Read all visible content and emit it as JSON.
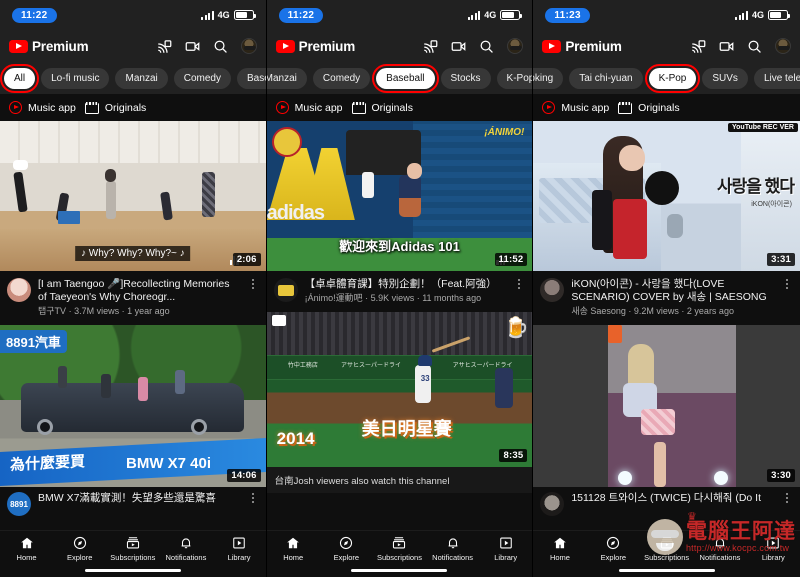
{
  "app": {
    "brand": "Premium",
    "yt_logo_color": "#ff0000",
    "header_icons": [
      "cast-icon",
      "add-video-icon",
      "search-icon",
      "avatar"
    ]
  },
  "panels": [
    {
      "status": {
        "time": "11:22",
        "network": "4G",
        "signal_bars": 4,
        "battery_pct": 72
      },
      "chips": [
        {
          "label": "All",
          "active": true,
          "highlighted": true
        },
        {
          "label": "Lo-fi music",
          "active": false,
          "highlighted": false
        },
        {
          "label": "Manzai",
          "active": false,
          "highlighted": false
        },
        {
          "label": "Comedy",
          "active": false,
          "highlighted": false
        },
        {
          "label": "Baseb",
          "active": false,
          "highlighted": false
        }
      ],
      "shelf": [
        {
          "label": "Music app",
          "icon": "music-app-icon"
        },
        {
          "label": "Originals",
          "icon": "originals-icon"
        }
      ],
      "videos": [
        {
          "title": "[I am Taengoo 🎤]Recollecting Memories of Taeyeon's Why Choreogr...",
          "channel": "탭구TV",
          "views": "3.7M views",
          "age": "1 year ago",
          "duration": "2:06",
          "caption_overlay": "♪ Why? Why? Why?~ ♪",
          "has_cc_badge": true
        },
        {
          "title": "BMW X7滿載實測！失望多些還是驚喜",
          "overlay_brand": "8891汽車",
          "overlay_text": "BMW X7 40i",
          "overlay_text2": "為什麼要買",
          "duration": "14:06"
        }
      ],
      "bottom_nav": [
        {
          "label": "Home",
          "icon": "home-icon",
          "active": true
        },
        {
          "label": "Explore",
          "icon": "compass-icon",
          "active": false
        },
        {
          "label": "Subscriptions",
          "icon": "subscriptions-icon",
          "active": false
        },
        {
          "label": "Notifications",
          "icon": "bell-icon",
          "active": false
        },
        {
          "label": "Library",
          "icon": "library-icon",
          "active": false
        }
      ]
    },
    {
      "status": {
        "time": "11:22",
        "network": "4G",
        "signal_bars": 4,
        "battery_pct": 72
      },
      "chips": [
        {
          "label": "Manzai",
          "active": false,
          "highlighted": false
        },
        {
          "label": "Comedy",
          "active": false,
          "highlighted": false
        },
        {
          "label": "Baseball",
          "active": true,
          "highlighted": true
        },
        {
          "label": "Stocks",
          "active": false,
          "highlighted": false
        },
        {
          "label": "K-Pop",
          "active": false,
          "highlighted": false
        }
      ],
      "shelf": [
        {
          "label": "Music app",
          "icon": "music-app-icon"
        },
        {
          "label": "Originals",
          "icon": "originals-icon"
        }
      ],
      "videos": [
        {
          "title": "【卓卓體育課】特別企劃！（Feat.阿強）",
          "channel": "¡Ánimo!運動吧",
          "views": "5.9K views",
          "age": "11 months ago",
          "duration": "11:52",
          "caption_overlay": "歡迎來到Adidas 101",
          "has_cc_badge": true
        },
        {
          "title": "",
          "overlay_text": "2014",
          "overlay_text2": "美日明星賽",
          "duration": "8:35",
          "strip_text": "台南Josh viewers also watch this channel"
        }
      ],
      "bottom_nav": [
        {
          "label": "Home",
          "icon": "home-icon",
          "active": true
        },
        {
          "label": "Explore",
          "icon": "compass-icon",
          "active": false
        },
        {
          "label": "Subscriptions",
          "icon": "subscriptions-icon",
          "active": false
        },
        {
          "label": "Notifications",
          "icon": "bell-icon",
          "active": false
        },
        {
          "label": "Library",
          "icon": "library-icon",
          "active": false
        }
      ]
    },
    {
      "status": {
        "time": "11:23",
        "network": "4G",
        "signal_bars": 4,
        "battery_pct": 72
      },
      "chips": [
        {
          "label": "oking",
          "active": false,
          "highlighted": false
        },
        {
          "label": "Tai chi-yuan",
          "active": false,
          "highlighted": false
        },
        {
          "label": "K-Pop",
          "active": true,
          "highlighted": true
        },
        {
          "label": "SUVs",
          "active": false,
          "highlighted": false
        },
        {
          "label": "Live televis",
          "active": false,
          "highlighted": false
        }
      ],
      "shelf": [
        {
          "label": "Music app",
          "icon": "music-app-icon"
        },
        {
          "label": "Originals",
          "icon": "originals-icon"
        }
      ],
      "videos": [
        {
          "title": "iKON(아이콘) - 사랑을 했다(LOVE SCENARIO) COVER by 새송 | SAESONG",
          "channel": "새송 Saesong",
          "views": "9.2M views",
          "age": "2 years ago",
          "duration": "3:31",
          "caption_overlay": "사랑을 했다",
          "badge": "YouTube REC VER"
        },
        {
          "title": "151128 트와이스 (TWICE) 다시해줘 (Do It",
          "duration": "3:30"
        }
      ],
      "bottom_nav": [
        {
          "label": "Home",
          "icon": "home-icon",
          "active": true
        },
        {
          "label": "Explore",
          "icon": "compass-icon",
          "active": false
        },
        {
          "label": "Subscriptions",
          "icon": "subscriptions-icon",
          "active": false
        },
        {
          "label": "Notifications",
          "icon": "bell-icon",
          "active": false
        },
        {
          "label": "Library",
          "icon": "library-icon",
          "active": false
        }
      ]
    }
  ],
  "watermark": {
    "text": "電腦王阿達",
    "url": "http://www.kocpc.com.tw",
    "color": "#c62828"
  },
  "colors": {
    "accent": "#ff0000",
    "highlight_box": "#ff0000",
    "chip_active_bg": "#ffffff",
    "bg": "#0f0f0f",
    "bar_bg": "#212121"
  }
}
